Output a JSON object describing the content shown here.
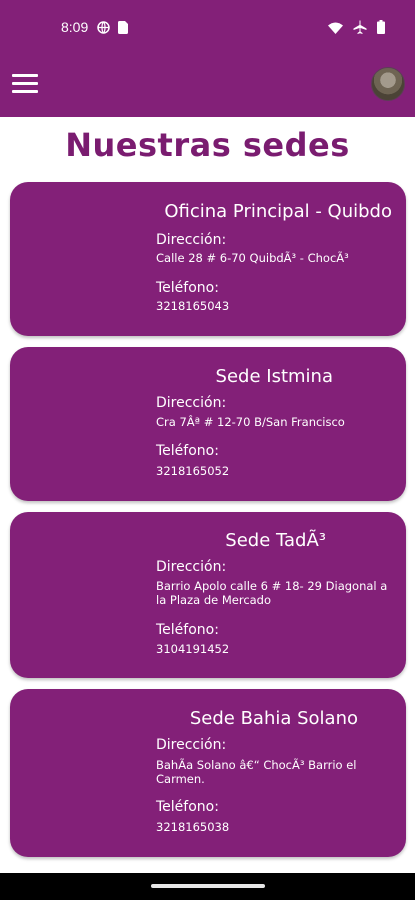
{
  "status_bar": {
    "time": "8:09",
    "left_icons": [
      "vpn-globe-icon",
      "sim-card-icon"
    ],
    "right_icons": [
      "wifi-icon",
      "airplane-icon",
      "battery-icon"
    ]
  },
  "app_bar": {
    "menu_icon": "hamburger-menu-icon",
    "avatar": "user-avatar"
  },
  "page": {
    "title": "Nuestras sedes"
  },
  "colors": {
    "primary": "#832078",
    "title": "#7a1c70",
    "background": "#ffffff"
  },
  "sedes": [
    {
      "name": "Oficina Principal - Quibdo",
      "direccion_label": "Dirección:",
      "direccion": "Calle 28 # 6-70 QuibdÃ³ - ChocÃ³",
      "telefono_label": "Teléfono:",
      "telefono": "3218165043"
    },
    {
      "name": "Sede Istmina",
      "direccion_label": "Dirección:",
      "direccion": "Cra 7Âª # 12-70 B/San Francisco",
      "telefono_label": "Teléfono:",
      "telefono": "3218165052"
    },
    {
      "name": "Sede TadÃ³",
      "direccion_label": "Dirección:",
      "direccion": "Barrio Apolo calle 6 # 18- 29 Diagonal a la Plaza de Mercado",
      "telefono_label": "Teléfono:",
      "telefono": "3104191452"
    },
    {
      "name": "Sede Bahia Solano",
      "direccion_label": "Dirección:",
      "direccion": "BahÃ­a Solano â€“ ChocÃ³ Barrio el Carmen.",
      "telefono_label": "Teléfono:",
      "telefono": "3218165038"
    }
  ]
}
